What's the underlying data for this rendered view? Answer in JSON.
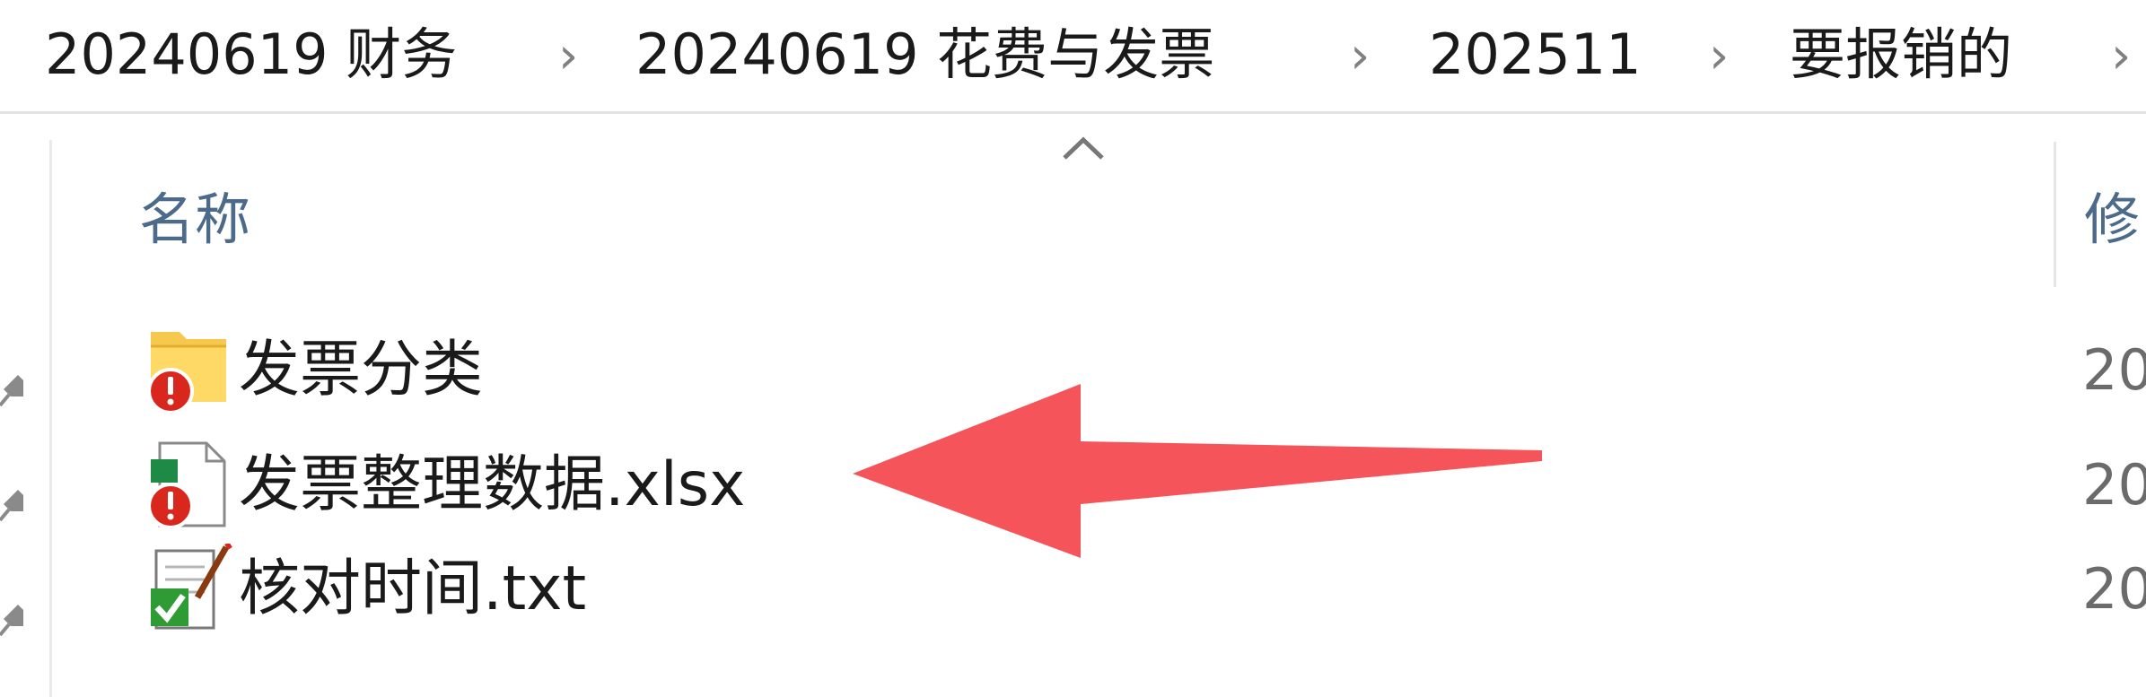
{
  "breadcrumb": {
    "items": [
      "20240619 财务",
      "20240619 花费与发票",
      "202511",
      "要报销的"
    ],
    "separator": "›"
  },
  "columns": {
    "name": "名称",
    "modified": "修"
  },
  "files": [
    {
      "name": "发票分类",
      "type": "folder",
      "date": "20",
      "icon": "folder-with-error-icon"
    },
    {
      "name": "发票整理数据.xlsx",
      "type": "xlsx",
      "date": "20",
      "icon": "excel-file-with-error-icon"
    },
    {
      "name": "核对时间.txt",
      "type": "txt",
      "date": "20",
      "icon": "text-file-synced-icon"
    }
  ],
  "colors": {
    "annotation_arrow": "#f4545a",
    "error_badge": "#d9271e",
    "sync_badge": "#2f9b35",
    "column_header": "#4c6a8a"
  }
}
